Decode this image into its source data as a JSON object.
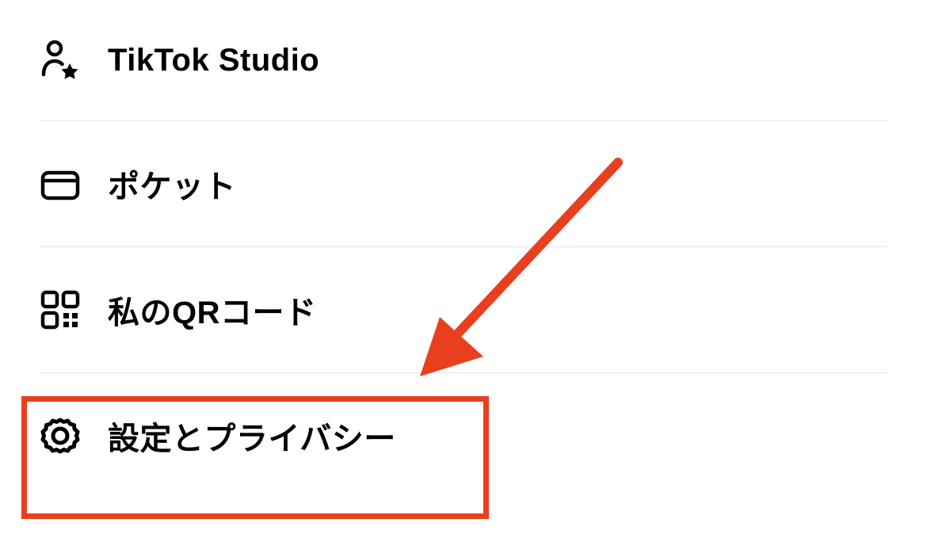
{
  "menu": {
    "items": [
      {
        "label": "TikTok Studio",
        "icon": "person-star-icon"
      },
      {
        "label": "ポケット",
        "icon": "wallet-icon"
      },
      {
        "label": "私のQRコード",
        "icon": "qr-code-icon"
      },
      {
        "label": "設定とプライバシー",
        "icon": "gear-icon"
      }
    ]
  },
  "annotation": {
    "highlight_color": "#e8401e",
    "arrow_color": "#e8401e"
  }
}
